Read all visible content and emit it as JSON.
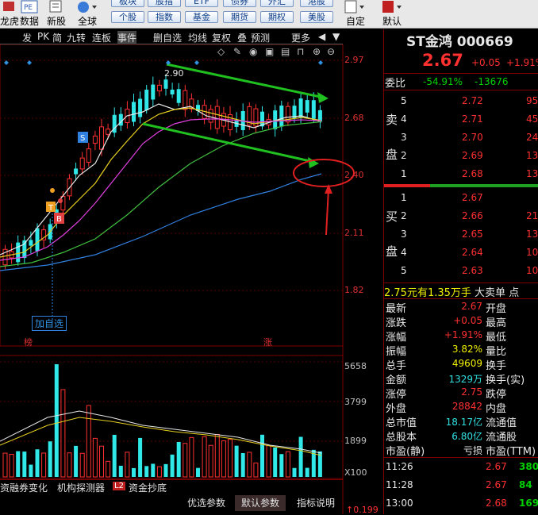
{
  "toolbar": {
    "items": [
      {
        "label": "龙虎",
        "icon": "dragon-tiger-icon"
      },
      {
        "label": "数据",
        "icon": "pe-data-icon"
      },
      {
        "label": "新股",
        "icon": "new-stock-icon"
      },
      {
        "label": "全球",
        "icon": "globe-icon"
      }
    ],
    "pe_text": "PE",
    "market_row1": [
      "板块",
      "股指",
      "ETF",
      "债券",
      "外汇",
      "港股"
    ],
    "market_row2": [
      "个股",
      "指数",
      "基金",
      "期货",
      "期权",
      "美股"
    ],
    "right_items": [
      {
        "label": "自定",
        "icon": "custom-icon"
      },
      {
        "label": "默认",
        "icon": "default-icon"
      }
    ]
  },
  "chart_toolbar": [
    "发",
    "PK",
    "简",
    "九转",
    "连板",
    "事件",
    "删自选",
    "均线",
    "复权",
    "叠",
    "预测",
    "更多"
  ],
  "price_axis": [
    "2.97",
    "2.68",
    "2.40",
    "2.11",
    "1.82"
  ],
  "volume_axis": [
    "5658",
    "3799",
    "1899",
    "X100"
  ],
  "annotations": {
    "high_label": "2.90",
    "add_watch": "加自选",
    "marker_t": "T",
    "marker_b": "B",
    "marker_s": "S",
    "bottom_tag_left": "榜",
    "bottom_tag_mid": "涨"
  },
  "bottom_tabs": [
    "资融券变化",
    "机构探测器",
    "L2",
    "资金抄底"
  ],
  "bottom_tabs_right": [
    "优选参数",
    "默认参数",
    "指标说明"
  ],
  "bottom_value": "0.199",
  "stock": {
    "name": "ST金鸿",
    "code": "000669",
    "price": "2.67",
    "change": "+0.05",
    "change_pct": "+1.91%",
    "weibi_label": "委比",
    "weibi_pct": "-54.91%",
    "weicha": "-13676"
  },
  "asks": [
    {
      "level": "5",
      "price": "2.72",
      "vol": "95"
    },
    {
      "level": "4",
      "price": "2.71",
      "vol": "45"
    },
    {
      "level": "3",
      "price": "2.70",
      "vol": "24"
    },
    {
      "level": "2",
      "price": "2.69",
      "vol": "13"
    },
    {
      "level": "1",
      "price": "2.68",
      "vol": "13"
    }
  ],
  "bids": [
    {
      "level": "1",
      "price": "2.67",
      "vol": ""
    },
    {
      "level": "2",
      "price": "2.66",
      "vol": "21"
    },
    {
      "level": "3",
      "price": "2.65",
      "vol": "13"
    },
    {
      "level": "4",
      "price": "2.64",
      "vol": "10"
    },
    {
      "level": "5",
      "price": "2.63",
      "vol": "10"
    }
  ],
  "ask_side_label": [
    "卖",
    "盘"
  ],
  "bid_side_label": [
    "买",
    "盘"
  ],
  "big_order": {
    "price": "2.75元有",
    "amount": "1.35万手",
    "label": "大卖单",
    "extra": "点"
  },
  "stats": [
    {
      "k1": "最新",
      "v1": "2.67",
      "c1": "red",
      "k2": "开盘"
    },
    {
      "k1": "涨跌",
      "v1": "+0.05",
      "c1": "red",
      "k2": "最高"
    },
    {
      "k1": "涨幅",
      "v1": "+1.91%",
      "c1": "red",
      "k2": "最低"
    },
    {
      "k1": "振幅",
      "v1": "3.82%",
      "c1": "yellow",
      "k2": "量比"
    },
    {
      "k1": "总手",
      "v1": "49609",
      "c1": "yellow",
      "k2": "换手"
    },
    {
      "k1": "金额",
      "v1": "1329万",
      "c1": "cyan",
      "k2": "换手(实)"
    },
    {
      "k1": "涨停",
      "v1": "2.75",
      "c1": "red",
      "k2": "跌停"
    },
    {
      "k1": "外盘",
      "v1": "28842",
      "c1": "red",
      "k2": "内盘"
    },
    {
      "k1": "总市值",
      "v1": "18.17亿",
      "c1": "cyan",
      "k2": "流通值"
    },
    {
      "k1": "总股本",
      "v1": "6.80亿",
      "c1": "cyan",
      "k2": "流通股"
    },
    {
      "k1": "市盈(静)",
      "v1": "亏损",
      "c1": "white",
      "k2": "市盈(TTM)"
    }
  ],
  "ticks": [
    {
      "time": "11:26",
      "price": "2.67",
      "vol": "380"
    },
    {
      "time": "11:28",
      "price": "2.67",
      "vol": "84"
    },
    {
      "time": "13:00",
      "price": "2.68",
      "vol": "169"
    }
  ],
  "colors": {
    "up": "#ff3030",
    "down": "#30e0e0",
    "arrow_green": "#20c020",
    "circle_red": "#e02020"
  }
}
